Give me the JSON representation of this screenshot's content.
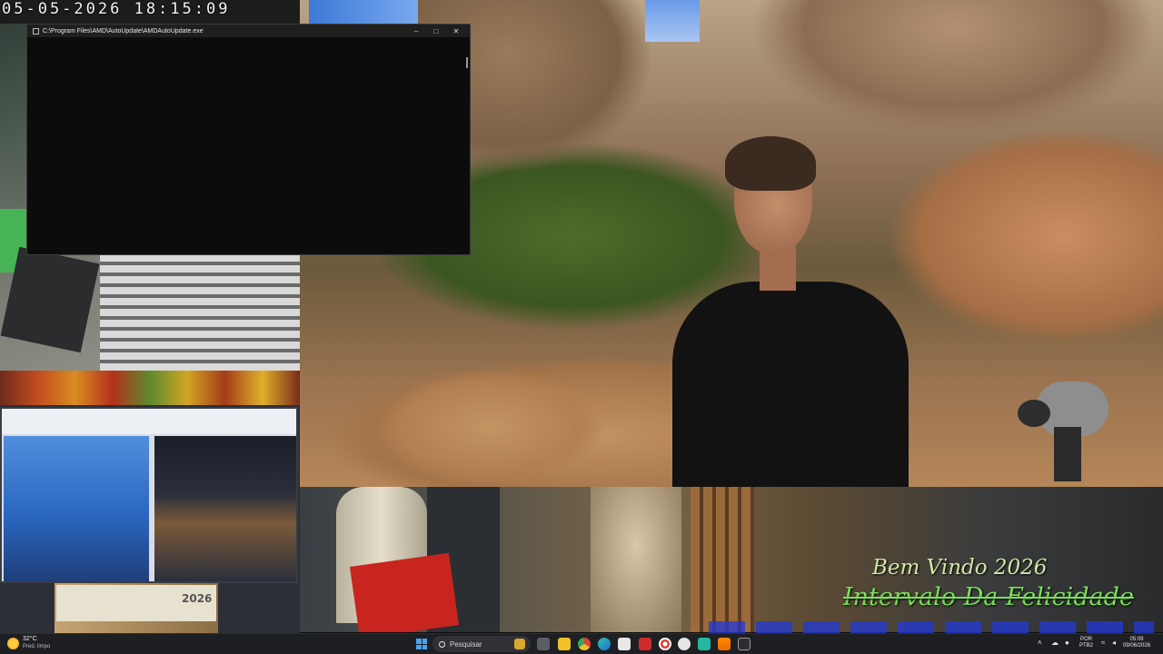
{
  "overlay": {
    "timestamp": "05-05-2026 18:15:09",
    "welcome_text": "Bem Vindo 2026",
    "interval_text": "Intervalo Da Felicidade",
    "calendar_year": "2026"
  },
  "console_window": {
    "title": "C:\\Program Files\\AMD\\AutoUpdate\\AMDAutoUpdate.exe",
    "minimize": "–",
    "maximize": "□",
    "close": "✕",
    "bg_color": "#0c0c0c"
  },
  "taskbar": {
    "weather": {
      "temperature": "32°C",
      "condition": "Pred. limpo",
      "icon": "sun-icon"
    },
    "search_placeholder": "Pesquisar",
    "pinned_icons": [
      "start-icon",
      "task-view-icon",
      "file-explorer-icon",
      "chrome-icon",
      "edge-icon",
      "store-icon",
      "app-red-icon",
      "app-target-icon",
      "obs-icon",
      "app-green-icon",
      "vlc-icon",
      "terminal-icon"
    ],
    "tray": {
      "language_line1": "POR",
      "language_line2": "PTB2",
      "time": "05:09",
      "date": "09/06/2026"
    },
    "accent": "#4aa3f2"
  }
}
